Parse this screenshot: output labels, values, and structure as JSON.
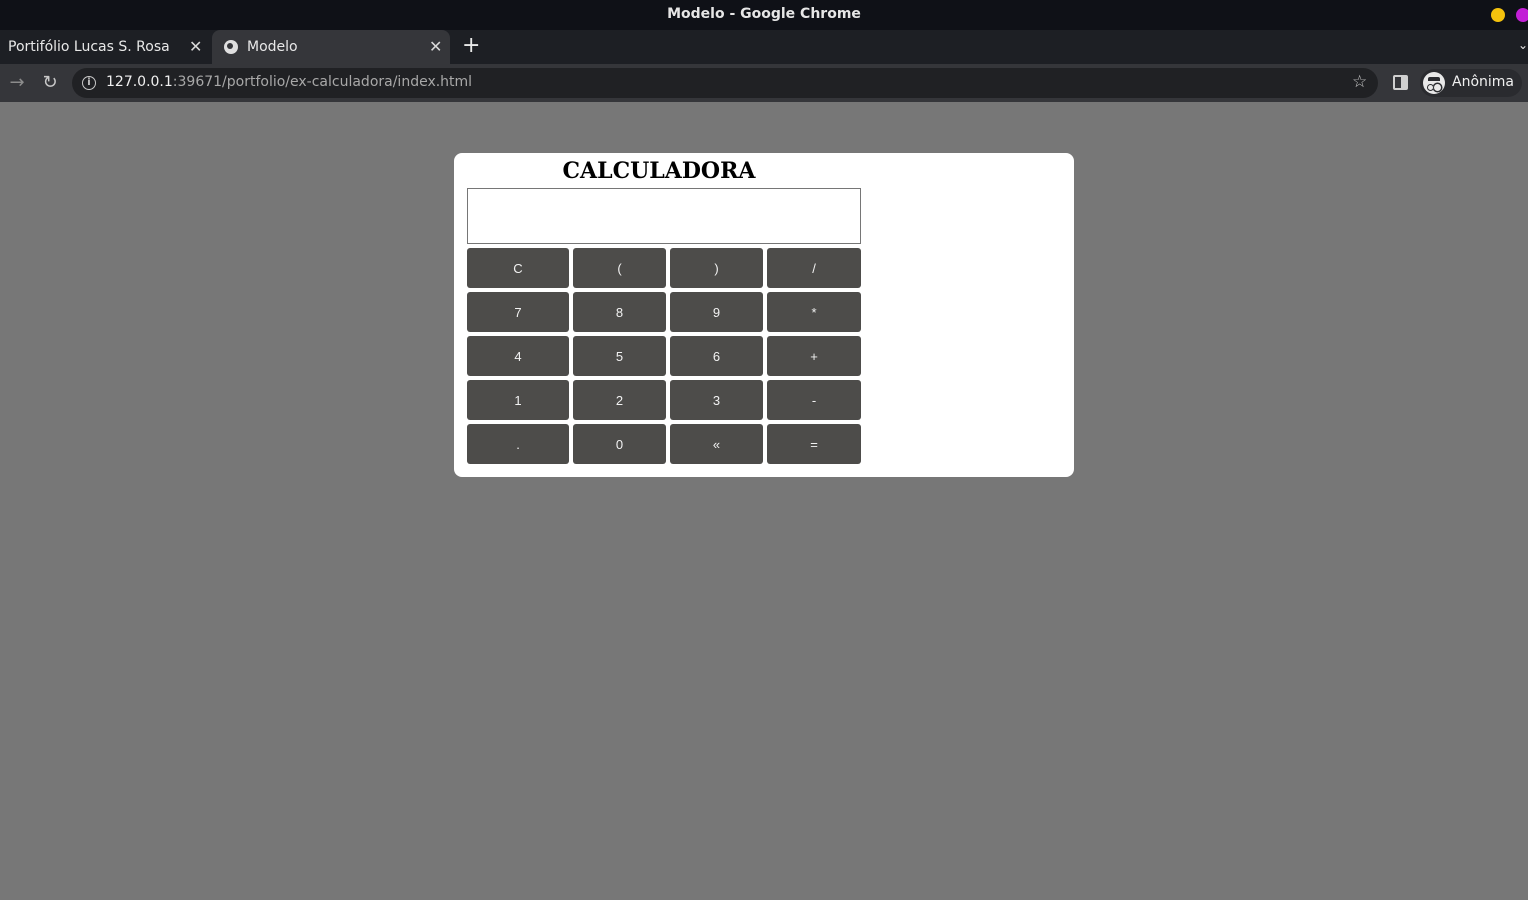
{
  "window": {
    "title": "Modelo - Google Chrome"
  },
  "tabs": [
    {
      "label": "Portifólio Lucas S. Rosa",
      "close": "✕"
    },
    {
      "label": "Modelo",
      "close": "✕"
    }
  ],
  "tabstrip": {
    "new_tab": "+",
    "menu": "⌄"
  },
  "toolbar": {
    "forward": "→",
    "reload": "↻",
    "url_host": "127.0.0.1",
    "url_rest": ":39671/portfolio/ex-calculadora/index.html",
    "star": "☆",
    "profile_label": "Anônima"
  },
  "calculator": {
    "title": "CALCULADORA",
    "display_value": "",
    "keys": [
      [
        "C",
        "(",
        ")",
        "/"
      ],
      [
        "7",
        "8",
        "9",
        "*"
      ],
      [
        "4",
        "5",
        "6",
        "+"
      ],
      [
        "1",
        "2",
        "3",
        "-"
      ],
      [
        ".",
        "0",
        "«",
        "="
      ]
    ]
  }
}
